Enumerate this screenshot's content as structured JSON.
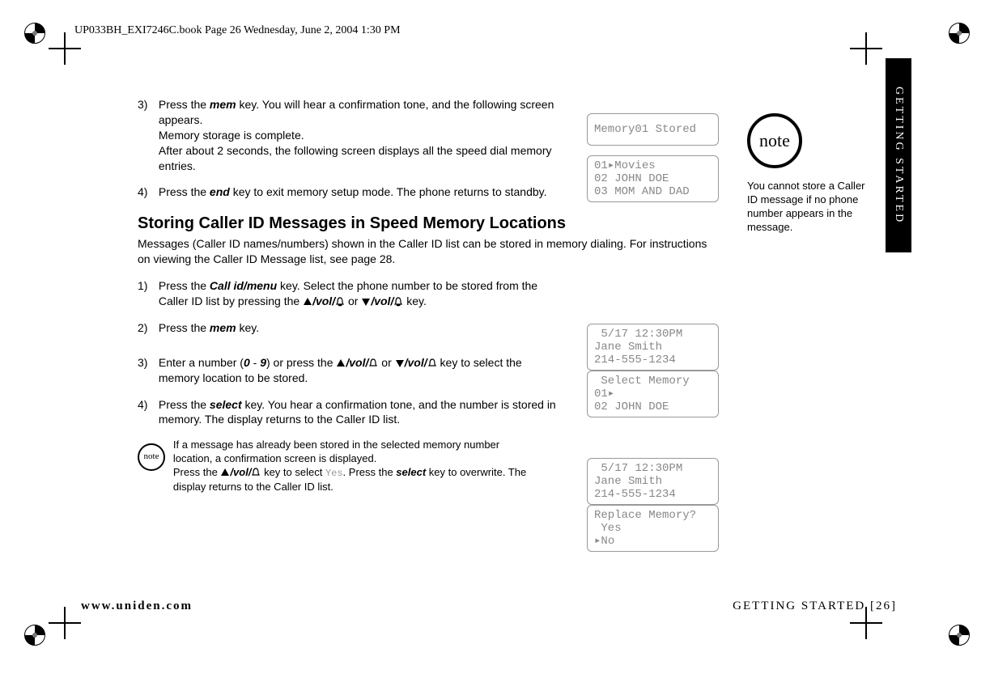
{
  "header_line": "UP033BH_EXI7246C.book  Page 26  Wednesday, June 2, 2004  1:30 PM",
  "side_tab": "GETTING STARTED",
  "steps": {
    "s3_num": "3)",
    "s3_a": "Press the ",
    "s3_mem": "mem",
    "s3_b": " key. You will hear a confirmation tone, and the following screen appears.",
    "s3_c": "Memory storage is complete.",
    "s3_d": "After about 2 seconds, the following screen displays all the speed dial memory entries.",
    "s4_num": "4)",
    "s4_a": "Press the ",
    "s4_end": "end",
    "s4_b": " key to exit memory setup mode. The phone returns to standby."
  },
  "heading": "Storing Caller ID Messages in Speed Memory Locations",
  "intro": "Messages (Caller ID names/numbers) shown in the Caller ID list can be stored in memory dialing. For instructions on viewing the Caller ID Message list, see page 28.",
  "steps2": {
    "s1_num": "1)",
    "s1_a": "Press the ",
    "s1_key": "Call id/menu",
    "s1_b": " key. Select the phone number to be stored from the Caller ID list by pressing the ",
    "vol": "/vol/",
    "s1_or": " or ",
    "s1_c": " key.",
    "s2_num": "2)",
    "s2_a": "Press the ",
    "s2_mem": "mem",
    "s2_b": " key.",
    "s3_num": "3)",
    "s3_a": "Enter a number (",
    "s3_zero": "0",
    "s3_dash": " - ",
    "s3_nine": "9",
    "s3_b": ") or press the ",
    "s3_or": " or ",
    "s3_c": " key to select the memory location to be stored.",
    "s4_num": "4)",
    "s4_a": "Press the ",
    "s4_select": "select",
    "s4_b": " key. You hear a confirmation tone, and the number is stored in memory. The display returns to the Caller ID list."
  },
  "subnote": {
    "a": "If a message has already been stored in the selected memory number location, a confirmation screen is displayed.",
    "b1": "Press the ",
    "b2": " key to select ",
    "yes": "Yes",
    "b3": ". Press the ",
    "select": "select",
    "b4": " key to overwrite. The display returns to the Caller ID list."
  },
  "lcd": {
    "l1": "Memory01 Stored",
    "l2": "01▸Movies\n02 JOHN DOE\n03 MOM AND DAD",
    "l3": " 5/17 12:30PM\nJane Smith\n214-555-1234",
    "l4": " Select Memory\n01▸\n02 JOHN DOE",
    "l5": " 5/17 12:30PM\nJane Smith\n214-555-1234",
    "l6": "Replace Memory?\n Yes\n▸No"
  },
  "note_text": "You cannot store a Caller ID message if no phone number appears in the message.",
  "note_label": "note",
  "footer_left": "www.uniden.com",
  "footer_right": "GETTING STARTED [26]"
}
